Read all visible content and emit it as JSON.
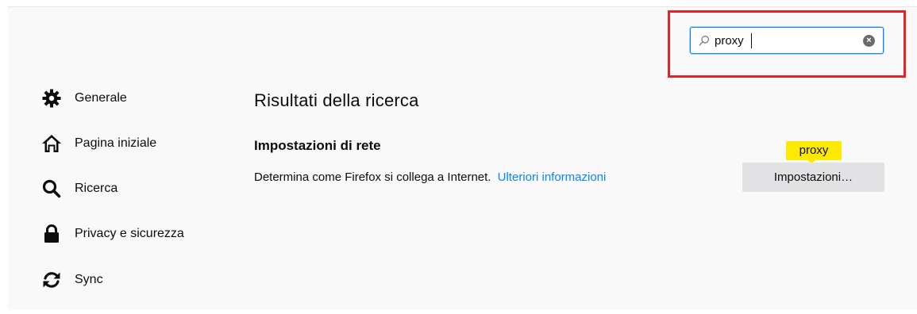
{
  "search": {
    "value": "proxy",
    "icons": {
      "search": "search-icon",
      "clear": "clear-icon"
    }
  },
  "sidebar": {
    "items": [
      {
        "label": "Generale",
        "icon": "gear-icon"
      },
      {
        "label": "Pagina iniziale",
        "icon": "home-icon"
      },
      {
        "label": "Ricerca",
        "icon": "search-icon"
      },
      {
        "label": "Privacy e sicurezza",
        "icon": "lock-icon"
      },
      {
        "label": "Sync",
        "icon": "sync-icon"
      }
    ]
  },
  "main": {
    "results_title": "Risultati della ricerca",
    "network": {
      "title": "Impostazioni di rete",
      "description": "Determina come Firefox si collega a Internet.",
      "learn_more": "Ulteriori informazioni",
      "badge": "proxy",
      "button": "Impostazioni…"
    }
  },
  "colors": {
    "link": "#0a84ff",
    "badge": "#ffe900",
    "highlight_frame": "#e3222a",
    "search_focus": "#0a84ff",
    "button_bg": "#e2e2e4"
  }
}
